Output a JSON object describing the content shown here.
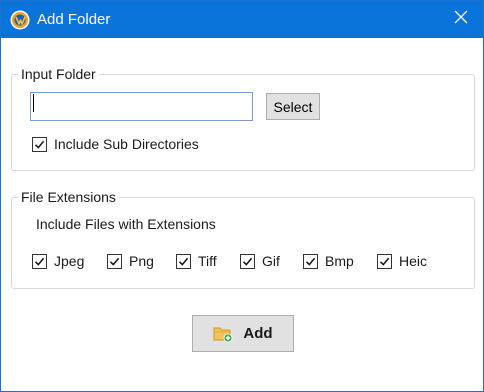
{
  "window": {
    "title": "Add Folder",
    "app_icon": "app-logo-icon",
    "close_icon": "close-icon"
  },
  "input_folder": {
    "legend": "Input Folder",
    "path_value": "",
    "path_placeholder": "",
    "select_label": "Select",
    "include_subdirs_label": "Include Sub Directories",
    "include_subdirs_checked": true
  },
  "file_extensions": {
    "legend": "File Extensions",
    "description": "Include Files with Extensions",
    "items": [
      {
        "label": "Jpeg",
        "checked": true
      },
      {
        "label": "Png",
        "checked": true
      },
      {
        "label": "Tiff",
        "checked": true
      },
      {
        "label": "Gif",
        "checked": true
      },
      {
        "label": "Bmp",
        "checked": true
      },
      {
        "label": "Heic",
        "checked": true
      }
    ]
  },
  "footer": {
    "add_label": "Add",
    "add_icon": "add-folder-icon"
  },
  "colors": {
    "titlebar": "#0a74da",
    "button_face": "#e1e1e1",
    "group_border": "#d9d9d9"
  }
}
